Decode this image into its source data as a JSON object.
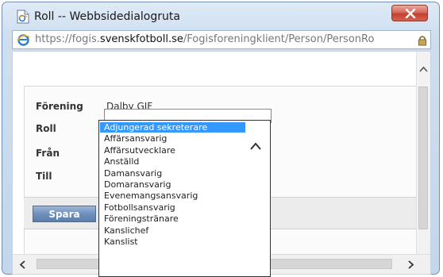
{
  "window": {
    "title": "Roll -- Webbsidedialogruta",
    "url_prefix": "https://",
    "url_domain_pre": "fogis.",
    "url_domain": "svenskfotboll.se",
    "url_path": "/Fogisforeningklient/Person/PersonRo"
  },
  "form": {
    "forening_label": "Förening",
    "forening_value": "Dalby GIF",
    "roll_label": "Roll",
    "fran_label": "Från",
    "till_label": "Till",
    "save_label": "Spara"
  },
  "dropdown": {
    "selected_index": 0,
    "options": [
      "Adjungerad sekreterare",
      "Affärsansvarig",
      "Affärsutvecklare",
      "Anställd",
      "Damansvarig",
      "Domaransvarig",
      "Evenemangsansvarig",
      "Fotbollsansvarig",
      "Föreningstränare",
      "Kanslichef",
      "Kanslist"
    ]
  },
  "colors": {
    "selection": "#3399ff",
    "close_button": "#c4402f",
    "save_button": "#6f8fbb"
  },
  "icons": {
    "title": "ie-page-icon",
    "address": "internet-explorer-icon",
    "secure": "lock-icon",
    "close": "close-icon"
  }
}
